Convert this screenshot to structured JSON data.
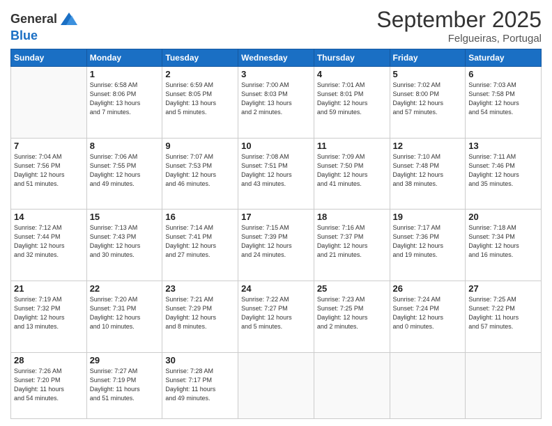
{
  "header": {
    "logo_line1": "General",
    "logo_line2": "Blue",
    "month": "September 2025",
    "location": "Felgueiras, Portugal"
  },
  "days_of_week": [
    "Sunday",
    "Monday",
    "Tuesday",
    "Wednesday",
    "Thursday",
    "Friday",
    "Saturday"
  ],
  "weeks": [
    [
      {
        "day": "",
        "info": ""
      },
      {
        "day": "1",
        "info": "Sunrise: 6:58 AM\nSunset: 8:06 PM\nDaylight: 13 hours\nand 7 minutes."
      },
      {
        "day": "2",
        "info": "Sunrise: 6:59 AM\nSunset: 8:05 PM\nDaylight: 13 hours\nand 5 minutes."
      },
      {
        "day": "3",
        "info": "Sunrise: 7:00 AM\nSunset: 8:03 PM\nDaylight: 13 hours\nand 2 minutes."
      },
      {
        "day": "4",
        "info": "Sunrise: 7:01 AM\nSunset: 8:01 PM\nDaylight: 12 hours\nand 59 minutes."
      },
      {
        "day": "5",
        "info": "Sunrise: 7:02 AM\nSunset: 8:00 PM\nDaylight: 12 hours\nand 57 minutes."
      },
      {
        "day": "6",
        "info": "Sunrise: 7:03 AM\nSunset: 7:58 PM\nDaylight: 12 hours\nand 54 minutes."
      }
    ],
    [
      {
        "day": "7",
        "info": "Sunrise: 7:04 AM\nSunset: 7:56 PM\nDaylight: 12 hours\nand 51 minutes."
      },
      {
        "day": "8",
        "info": "Sunrise: 7:06 AM\nSunset: 7:55 PM\nDaylight: 12 hours\nand 49 minutes."
      },
      {
        "day": "9",
        "info": "Sunrise: 7:07 AM\nSunset: 7:53 PM\nDaylight: 12 hours\nand 46 minutes."
      },
      {
        "day": "10",
        "info": "Sunrise: 7:08 AM\nSunset: 7:51 PM\nDaylight: 12 hours\nand 43 minutes."
      },
      {
        "day": "11",
        "info": "Sunrise: 7:09 AM\nSunset: 7:50 PM\nDaylight: 12 hours\nand 41 minutes."
      },
      {
        "day": "12",
        "info": "Sunrise: 7:10 AM\nSunset: 7:48 PM\nDaylight: 12 hours\nand 38 minutes."
      },
      {
        "day": "13",
        "info": "Sunrise: 7:11 AM\nSunset: 7:46 PM\nDaylight: 12 hours\nand 35 minutes."
      }
    ],
    [
      {
        "day": "14",
        "info": "Sunrise: 7:12 AM\nSunset: 7:44 PM\nDaylight: 12 hours\nand 32 minutes."
      },
      {
        "day": "15",
        "info": "Sunrise: 7:13 AM\nSunset: 7:43 PM\nDaylight: 12 hours\nand 30 minutes."
      },
      {
        "day": "16",
        "info": "Sunrise: 7:14 AM\nSunset: 7:41 PM\nDaylight: 12 hours\nand 27 minutes."
      },
      {
        "day": "17",
        "info": "Sunrise: 7:15 AM\nSunset: 7:39 PM\nDaylight: 12 hours\nand 24 minutes."
      },
      {
        "day": "18",
        "info": "Sunrise: 7:16 AM\nSunset: 7:37 PM\nDaylight: 12 hours\nand 21 minutes."
      },
      {
        "day": "19",
        "info": "Sunrise: 7:17 AM\nSunset: 7:36 PM\nDaylight: 12 hours\nand 19 minutes."
      },
      {
        "day": "20",
        "info": "Sunrise: 7:18 AM\nSunset: 7:34 PM\nDaylight: 12 hours\nand 16 minutes."
      }
    ],
    [
      {
        "day": "21",
        "info": "Sunrise: 7:19 AM\nSunset: 7:32 PM\nDaylight: 12 hours\nand 13 minutes."
      },
      {
        "day": "22",
        "info": "Sunrise: 7:20 AM\nSunset: 7:31 PM\nDaylight: 12 hours\nand 10 minutes."
      },
      {
        "day": "23",
        "info": "Sunrise: 7:21 AM\nSunset: 7:29 PM\nDaylight: 12 hours\nand 8 minutes."
      },
      {
        "day": "24",
        "info": "Sunrise: 7:22 AM\nSunset: 7:27 PM\nDaylight: 12 hours\nand 5 minutes."
      },
      {
        "day": "25",
        "info": "Sunrise: 7:23 AM\nSunset: 7:25 PM\nDaylight: 12 hours\nand 2 minutes."
      },
      {
        "day": "26",
        "info": "Sunrise: 7:24 AM\nSunset: 7:24 PM\nDaylight: 12 hours\nand 0 minutes."
      },
      {
        "day": "27",
        "info": "Sunrise: 7:25 AM\nSunset: 7:22 PM\nDaylight: 11 hours\nand 57 minutes."
      }
    ],
    [
      {
        "day": "28",
        "info": "Sunrise: 7:26 AM\nSunset: 7:20 PM\nDaylight: 11 hours\nand 54 minutes."
      },
      {
        "day": "29",
        "info": "Sunrise: 7:27 AM\nSunset: 7:19 PM\nDaylight: 11 hours\nand 51 minutes."
      },
      {
        "day": "30",
        "info": "Sunrise: 7:28 AM\nSunset: 7:17 PM\nDaylight: 11 hours\nand 49 minutes."
      },
      {
        "day": "",
        "info": ""
      },
      {
        "day": "",
        "info": ""
      },
      {
        "day": "",
        "info": ""
      },
      {
        "day": "",
        "info": ""
      }
    ]
  ]
}
